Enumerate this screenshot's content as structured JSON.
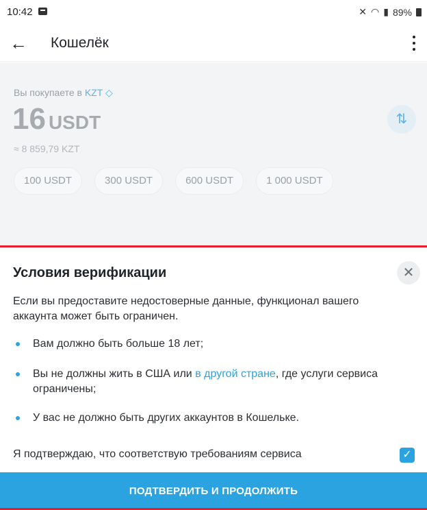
{
  "status_bar": {
    "time": "10:42",
    "battery": "89%"
  },
  "app_bar": {
    "back_icon": "arrow-left-icon",
    "title": "Кошелёк",
    "more_icon": "more-vertical-icon"
  },
  "purchase": {
    "buying_label": "Вы покупаете в",
    "currency": "KZT",
    "amount": "16",
    "amount_unit": "USDT",
    "approx": "≈ 8 859,79 KZT",
    "presets": [
      "100 USDT",
      "300 USDT",
      "600 USDT",
      "1 000 USDT"
    ]
  },
  "sheet": {
    "title": "Условия верификации",
    "intro": "Если вы предоставите недостоверные данные, функционал вашего аккаунта может быть ограничен.",
    "req1": "Вам должно быть больше 18 лет;",
    "req2_before": "Вы не должны жить в США или ",
    "req2_link": "в другой стране",
    "req2_after": ", где услуги сервиса ограничены;",
    "req3": "У вас не должно быть других аккаунтов в Кошельке.",
    "confirm_label": "Я подтверждаю, что соответствую требованиям сервиса",
    "confirm_checked": true,
    "cta_label": "ПОДТВЕРДИТЬ И ПРОДОЛЖИТЬ"
  },
  "colors": {
    "accent": "#2aa3e0",
    "highlight": "#e5202a"
  }
}
